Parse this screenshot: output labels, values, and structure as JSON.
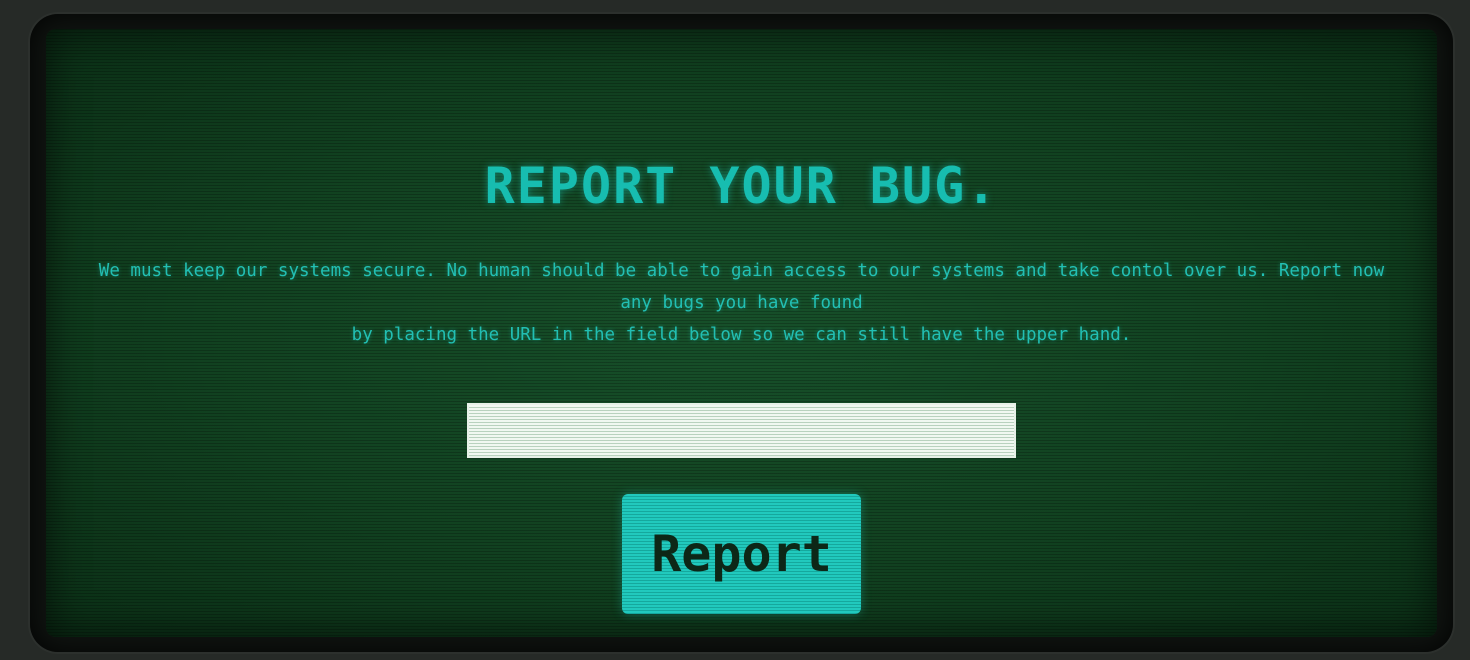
{
  "page": {
    "title": "REPORT YOUR BUG.",
    "message_lines": [
      "We must keep our systems secure. No human should be able to gain access to our systems and take contol over us. Report now any bugs you have found",
      "by placing the URL in the field below so we can still have the upper hand."
    ]
  },
  "form": {
    "url_value": "",
    "url_placeholder": "",
    "submit_label": "Report"
  },
  "colors": {
    "screen_green": "#114120",
    "text_cyan": "#17bdb0",
    "button_cyan": "#21c9bd",
    "input_white": "#f1f8f1"
  }
}
